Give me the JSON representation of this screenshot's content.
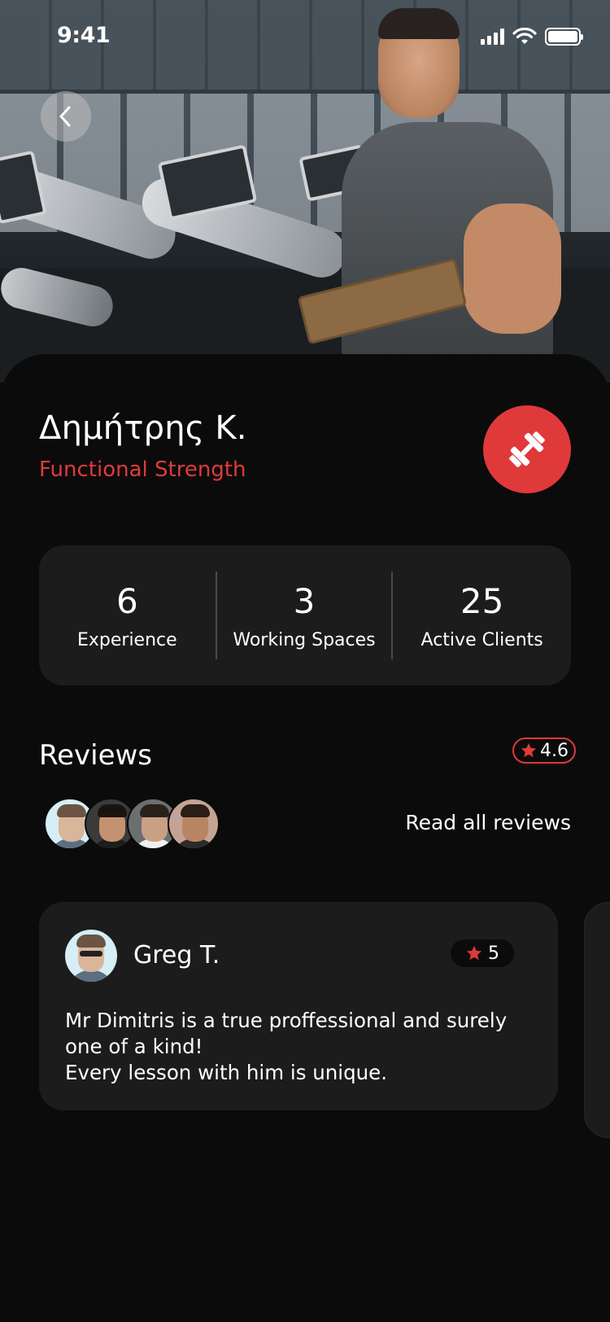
{
  "status_bar": {
    "time": "9:41"
  },
  "trainer": {
    "name": "Δημήτρης Κ.",
    "specialty": "Functional Strength"
  },
  "stats": [
    {
      "value": "6",
      "label": "Experience"
    },
    {
      "value": "3",
      "label": "Working Spaces"
    },
    {
      "value": "25",
      "label": "Active Clients"
    }
  ],
  "reviews": {
    "title": "Reviews",
    "average_rating": "4.6",
    "read_all_label": "Read all reviews",
    "items": [
      {
        "author": "Greg T.",
        "rating": "5",
        "text": "Mr Dimitris is a true proffessional and surely one of a kind!\nEvery lesson with him is unique."
      }
    ]
  },
  "colors": {
    "accent": "#e0393a",
    "background": "#0b0b0b",
    "card": "#1c1c1c"
  },
  "icons": {
    "back": "chevron-left-icon",
    "specialty": "dumbbell-icon",
    "star": "star-icon"
  }
}
